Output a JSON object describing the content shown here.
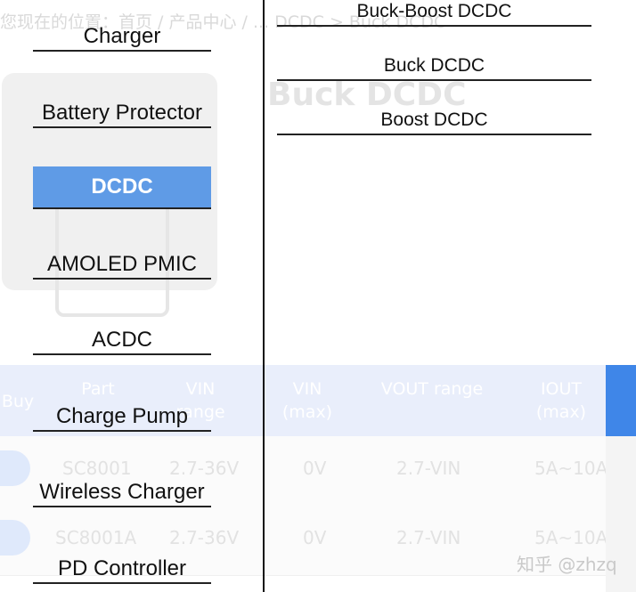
{
  "background": {
    "breadcrumb": "您现在的位置：首页 / 产品中心 / ... DCDC > Buck DCDC",
    "title": "Buck DCDC",
    "table": {
      "headers": [
        "Buy",
        "Part",
        "VIN range",
        "VIN (max)",
        "VOUT range",
        "IOUT (max)"
      ],
      "rows": [
        [
          "SC8001",
          "2.7-36V",
          "0V",
          "2.7-VIN",
          "5A~10A"
        ],
        [
          "SC8001A",
          "2.7-36V",
          "0V",
          "2.7-VIN",
          "5A~10A"
        ]
      ]
    }
  },
  "left_menu": {
    "items": [
      {
        "label": "Charger",
        "active": false
      },
      {
        "label": "Battery Protector",
        "active": false
      },
      {
        "label": "DCDC",
        "active": true
      },
      {
        "label": "AMOLED PMIC",
        "active": false
      },
      {
        "label": "ACDC",
        "active": false
      },
      {
        "label": "Charge Pump",
        "active": false
      },
      {
        "label": "Wireless Charger",
        "active": false
      },
      {
        "label": "PD Controller",
        "active": false
      }
    ]
  },
  "right_menu": {
    "items": [
      {
        "label": "Buck-Boost DCDC"
      },
      {
        "label": "Buck DCDC"
      },
      {
        "label": "Boost DCDC"
      }
    ]
  },
  "watermark": "知乎 @zhzq",
  "colors": {
    "active_bg": "#5f9be6",
    "active_text": "#ffffff",
    "table_header_accent": "#3f86e8"
  }
}
